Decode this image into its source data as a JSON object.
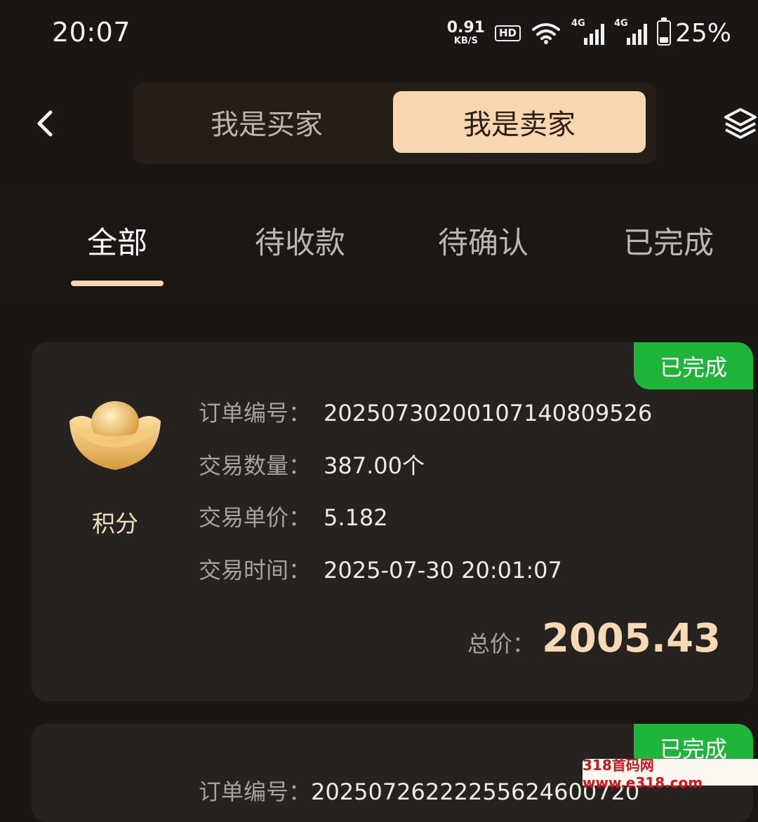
{
  "status": {
    "time": "20:07",
    "net_speed": "0.91",
    "net_unit": "KB/S",
    "hd": "HD",
    "sim1_label": "4G",
    "sim2_label": "4G",
    "battery_percent": "25%",
    "battery_level": 0.25
  },
  "nav": {
    "buyer_tab": "我是买家",
    "seller_tab": "我是卖家",
    "active": "seller"
  },
  "tabs": {
    "items": [
      "全部",
      "待收款",
      "待确认",
      "已完成"
    ],
    "active_index": 0
  },
  "orders": [
    {
      "status": "已完成",
      "product": "积分",
      "order_no_label": "订单编号：",
      "order_no": "202507302001071408095​26",
      "qty_label": "交易数量：",
      "qty": "387.00个",
      "price_label": "交易单价：",
      "price": "5.182",
      "time_label": "交易时间：",
      "time": "2025-07-30 20:01:07",
      "total_label": "总价：",
      "total": "2005.43"
    },
    {
      "status": "已完成",
      "order_no_label": "订单编号：",
      "order_no": "202507262222556246007​20"
    }
  ],
  "watermark": "318首码网 www.e318.com",
  "colors": {
    "background": "#1a1613",
    "card": "#262220",
    "accent": "#f8d7b0",
    "badge": "#1fb53a"
  }
}
